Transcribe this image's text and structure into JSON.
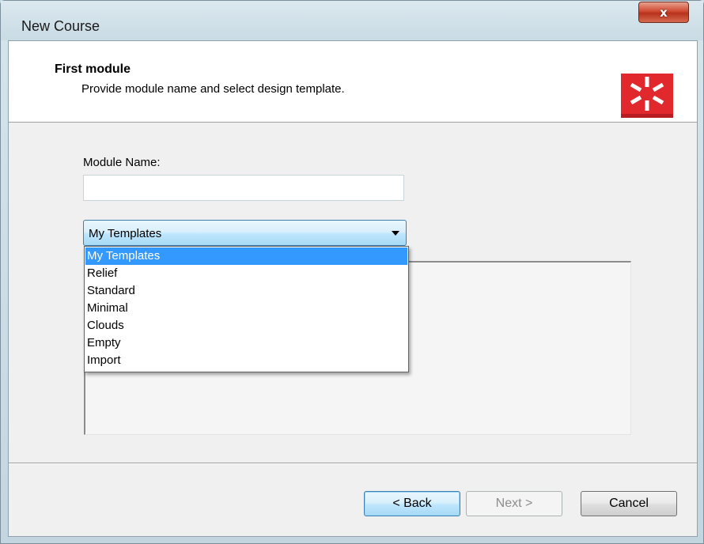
{
  "window": {
    "title": "New Course",
    "close_label": "x"
  },
  "header": {
    "title": "First module",
    "subtitle": "Provide module name and select design template."
  },
  "form": {
    "module_name_label": "Module Name:",
    "module_name_value": "",
    "module_name_placeholder": ""
  },
  "template_select": {
    "selected": "My Templates",
    "options": [
      "My Templates",
      "Relief",
      "Standard",
      "Minimal",
      "Clouds",
      "Empty",
      "Import"
    ],
    "highlighted_index": 0
  },
  "buttons": {
    "back": "< Back",
    "next": "Next >",
    "cancel": "Cancel"
  },
  "colors": {
    "logo_accent": "#e0282d",
    "selection_highlight": "#3399ff",
    "close_button": "#cf4a32"
  },
  "icons": {
    "close": "close-icon",
    "logo": "asterisk-logo-icon",
    "dropdown": "chevron-down-icon"
  }
}
